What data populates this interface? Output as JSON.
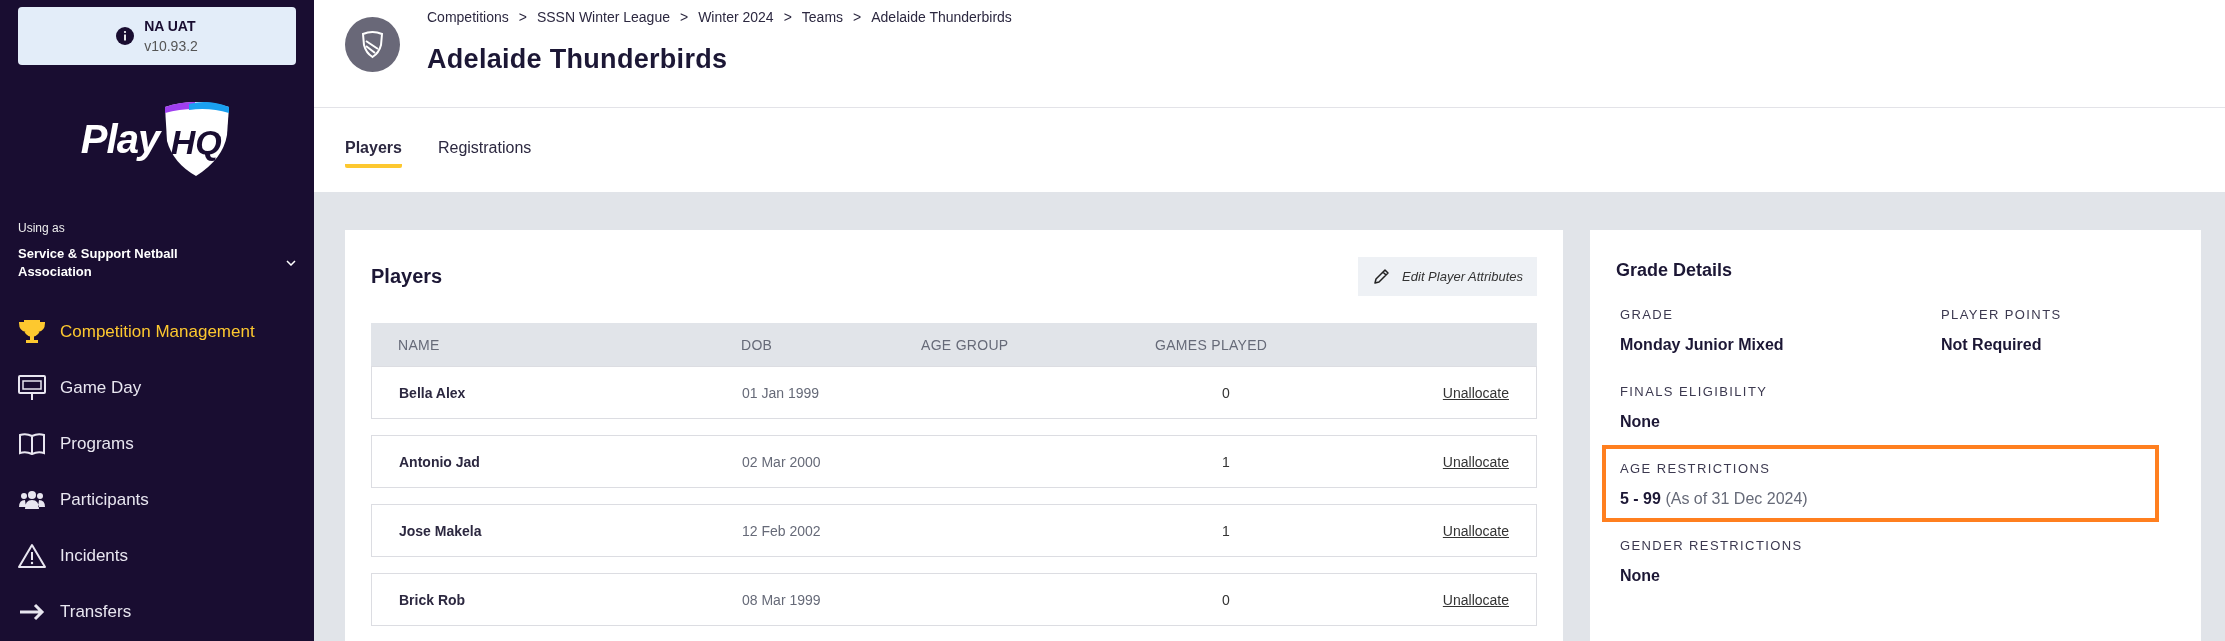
{
  "environment": {
    "name": "NA UAT",
    "version": "v10.93.2"
  },
  "logo": {
    "text": "Play",
    "badge": "HQ"
  },
  "account": {
    "label": "Using as",
    "organisation": "Service & Support Netball Association"
  },
  "nav": [
    {
      "label": "Competition Management",
      "kind": "trophy",
      "selected": true
    },
    {
      "label": "Game Day",
      "kind": "scoreboard",
      "selected": false
    },
    {
      "label": "Programs",
      "kind": "book",
      "selected": false
    },
    {
      "label": "Participants",
      "kind": "people",
      "selected": false
    },
    {
      "label": "Incidents",
      "kind": "warning",
      "selected": false
    },
    {
      "label": "Transfers",
      "kind": "transfer",
      "selected": false
    }
  ],
  "breadcrumbs": [
    "Competitions",
    "SSSN Winter League",
    "Winter 2024",
    "Teams",
    "Adelaide Thunderbirds"
  ],
  "breadcrumb_separator": ">",
  "page_title": "Adelaide Thunderbirds",
  "tabs": [
    {
      "label": "Players",
      "selected": true
    },
    {
      "label": "Registrations",
      "selected": false
    }
  ],
  "players": {
    "title": "Players",
    "edit_button": "Edit Player Attributes",
    "columns": [
      "NAME",
      "DOB",
      "AGE GROUP",
      "GAMES PLAYED"
    ],
    "rows": [
      {
        "name": "Bella Alex",
        "dob": "01 Jan 1999",
        "games_played": "0",
        "action": "Unallocate"
      },
      {
        "name": "Antonio Jad",
        "dob": "02 Mar 2000",
        "games_played": "1",
        "action": "Unallocate"
      },
      {
        "name": "Jose Makela",
        "dob": "12 Feb 2002",
        "games_played": "1",
        "action": "Unallocate"
      },
      {
        "name": "Brick Rob",
        "dob": "08 Mar 1999",
        "games_played": "0",
        "action": "Unallocate"
      }
    ]
  },
  "grade_details": {
    "title": "Grade Details",
    "fields": [
      {
        "label": "GRADE",
        "value": "Monday Junior Mixed",
        "highlighted": false
      },
      {
        "label": "PLAYER POINTS",
        "value": "Not Required",
        "highlighted": false
      },
      {
        "label": "FINALS ELIGIBILITY",
        "value": "None",
        "highlighted": false
      },
      {
        "label": "AGE RESTRICTIONS",
        "value": "5 - 99",
        "note": "(As of 31 Dec 2024)",
        "highlighted": true
      },
      {
        "label": "GENDER RESTRICTIONS",
        "value": "None",
        "highlighted": false
      }
    ]
  }
}
